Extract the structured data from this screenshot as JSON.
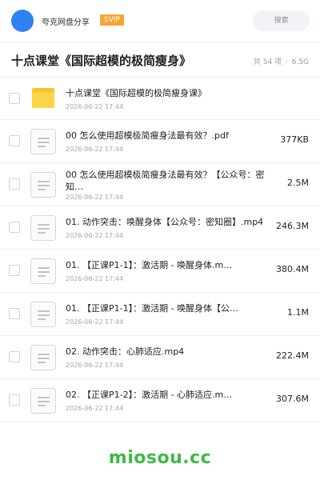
{
  "header": {
    "site_name": "夸克网盘分享",
    "badge": "SVIP",
    "search_label": "搜索"
  },
  "folder": {
    "title": "十点课堂《国际超模的极简瘦身》",
    "count_label": "共 54 项",
    "separator": "·",
    "total_size": "6.5G"
  },
  "files": [
    {
      "name": "十点课堂《国际超模的极简瘦身课》",
      "date": "2026-06-22 17:44",
      "size": "",
      "type": "folder"
    },
    {
      "name": "00 怎么使用超模极简瘦身法最有效？.pdf",
      "date": "2026-06-22 17:44",
      "size": "377KB",
      "type": "file"
    },
    {
      "name": "00 怎么使用超模极简瘦身法最有效？【公众号：密知…",
      "date": "2026-06-22 17:44",
      "size": "2.5M",
      "type": "file"
    },
    {
      "name": "01. 动作突击：唤醒身体【公众号：密知圈】.mp4",
      "date": "2026-06-22 17:44",
      "size": "246.3M",
      "type": "file"
    },
    {
      "name": "01. 【正课P1-1】：激活期 - 唤醒身体.m…",
      "date": "2026-06-22 17:44",
      "size": "380.4M",
      "type": "file"
    },
    {
      "name": "01. 【正课P1-1】：激活期 - 唤醒身体【公…",
      "date": "2026-06-22 17:44",
      "size": "1.1M",
      "type": "file"
    },
    {
      "name": "02. 动作突击：心肺适应.mp4",
      "date": "2026-06-22 17:44",
      "size": "222.4M",
      "type": "file"
    },
    {
      "name": "02. 【正课P1-2】：激活期 - 心肺适应.m…",
      "date": "2026-06-22 17:44",
      "size": "307.6M",
      "type": "file"
    }
  ],
  "watermark": "miosou.cc",
  "colors": {
    "avatar": "#2f7ff5",
    "svip_badge": "#f7a436",
    "folder": "#fbd44a",
    "watermark": "#3cbb43"
  }
}
